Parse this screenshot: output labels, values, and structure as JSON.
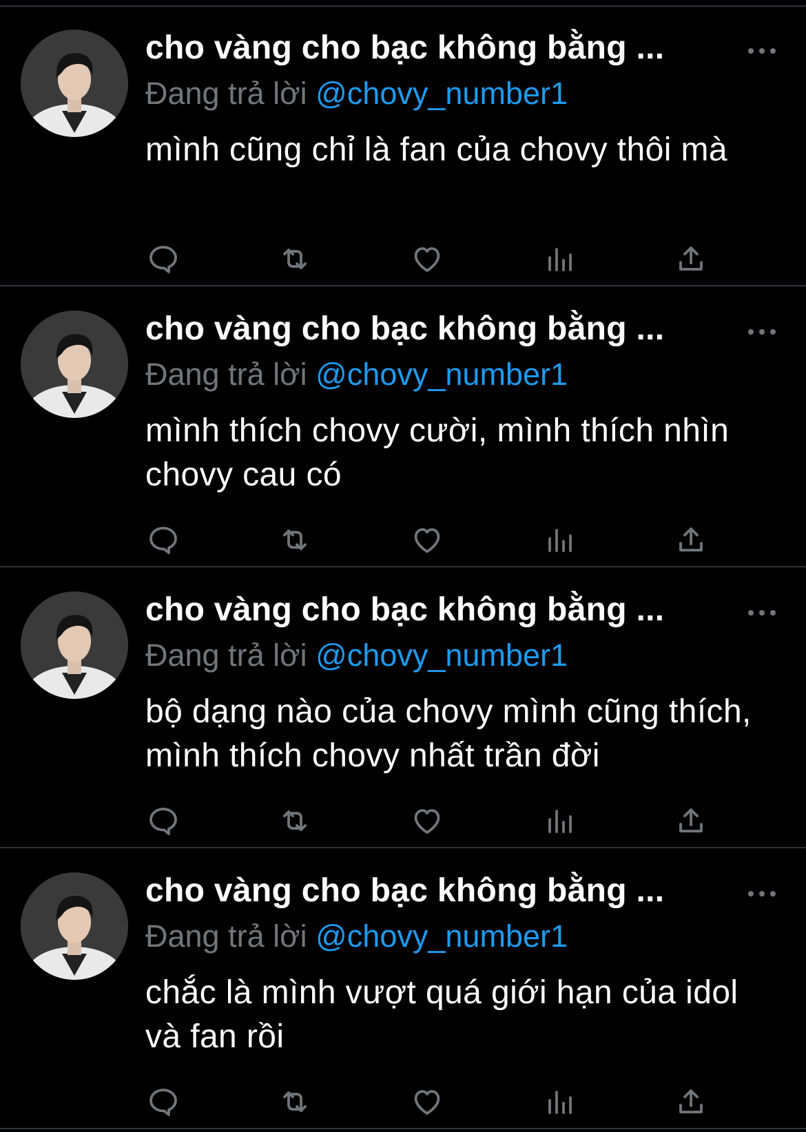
{
  "colors": {
    "background": "#000000",
    "divider": "#2f3336",
    "primary_text": "#ffffff",
    "secondary_text": "#71767b",
    "link": "#1d9bf0",
    "icon": "#71767b"
  },
  "icons": {
    "reply": "speech-bubble",
    "retweet": "two-arrows-loop",
    "like": "heart-outline",
    "views": "bar-chart",
    "share": "upload-arrow",
    "more": "three-dots-horizontal"
  },
  "tweets": [
    {
      "display_name": "cho vàng cho bạc không bằng ...",
      "reply_prefix": "Đang trả lời",
      "reply_handle": "@chovy_number1",
      "text": "mình cũng chỉ là fan của chovy thôi mà"
    },
    {
      "display_name": "cho vàng cho bạc không bằng ...",
      "reply_prefix": "Đang trả lời",
      "reply_handle": "@chovy_number1",
      "text": "mình thích chovy cười, mình thích nhìn chovy cau có"
    },
    {
      "display_name": "cho vàng cho bạc không bằng ...",
      "reply_prefix": "Đang trả lời",
      "reply_handle": "@chovy_number1",
      "text": "bộ dạng nào của chovy mình cũng thích, mình thích chovy nhất trần đời"
    },
    {
      "display_name": "cho vàng cho bạc không bằng ...",
      "reply_prefix": "Đang trả lời",
      "reply_handle": "@chovy_number1",
      "text": "chắc là mình vượt quá giới hạn của idol và fan rồi"
    }
  ]
}
